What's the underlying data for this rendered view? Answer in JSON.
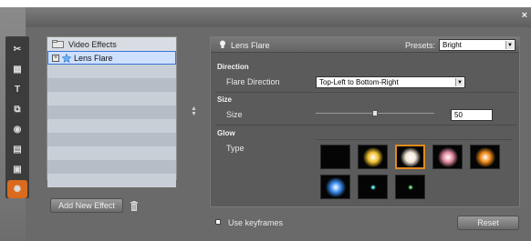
{
  "window": {
    "close_glyph": "×"
  },
  "toolstrip": {
    "tools": [
      {
        "name": "scissors-icon",
        "glyph": "✂"
      },
      {
        "name": "film-icon",
        "glyph": "▦"
      },
      {
        "name": "title-icon",
        "glyph": "T"
      },
      {
        "name": "overlay-icon",
        "glyph": "⧉"
      },
      {
        "name": "camera-icon",
        "glyph": "◉"
      },
      {
        "name": "clapper-icon",
        "glyph": "▤"
      },
      {
        "name": "snapshot-icon",
        "glyph": "▣"
      },
      {
        "name": "effects-icon",
        "glyph": "✺",
        "active": true
      }
    ]
  },
  "effects_list": {
    "header": "Video Effects",
    "items": [
      {
        "label": "Lens Flare",
        "selected": true
      }
    ],
    "add_button": "Add New Effect"
  },
  "effect_panel": {
    "title": "Lens Flare",
    "presets_label": "Presets:",
    "preset_value": "Bright",
    "sections": {
      "direction": "Direction",
      "size": "Size",
      "glow": "Glow"
    },
    "flare_direction_label": "Flare Direction",
    "flare_direction_value": "Top-Left to Bottom-Right",
    "size_label": "Size",
    "size_value": "50",
    "size_fraction": 0.5,
    "type_label": "Type",
    "glow_types": [
      {
        "name": "glow-black",
        "color": "#000000"
      },
      {
        "name": "glow-yellow",
        "color": "#f2c12e"
      },
      {
        "name": "glow-white",
        "color": "#f4e6d6",
        "selected": true
      },
      {
        "name": "glow-pink",
        "color": "#e58aa0"
      },
      {
        "name": "glow-orange",
        "color": "#f08a1a"
      },
      {
        "name": "glow-blue",
        "color": "#3a8cf0"
      },
      {
        "name": "glow-teal",
        "color": "#2fb4b4"
      },
      {
        "name": "glow-green",
        "color": "#2ea84a"
      }
    ]
  },
  "footer": {
    "keyframes_label": "Use keyframes",
    "reset_button": "Reset"
  },
  "colors": {
    "accent": "#d96a1e",
    "selection": "#3b73d8"
  }
}
